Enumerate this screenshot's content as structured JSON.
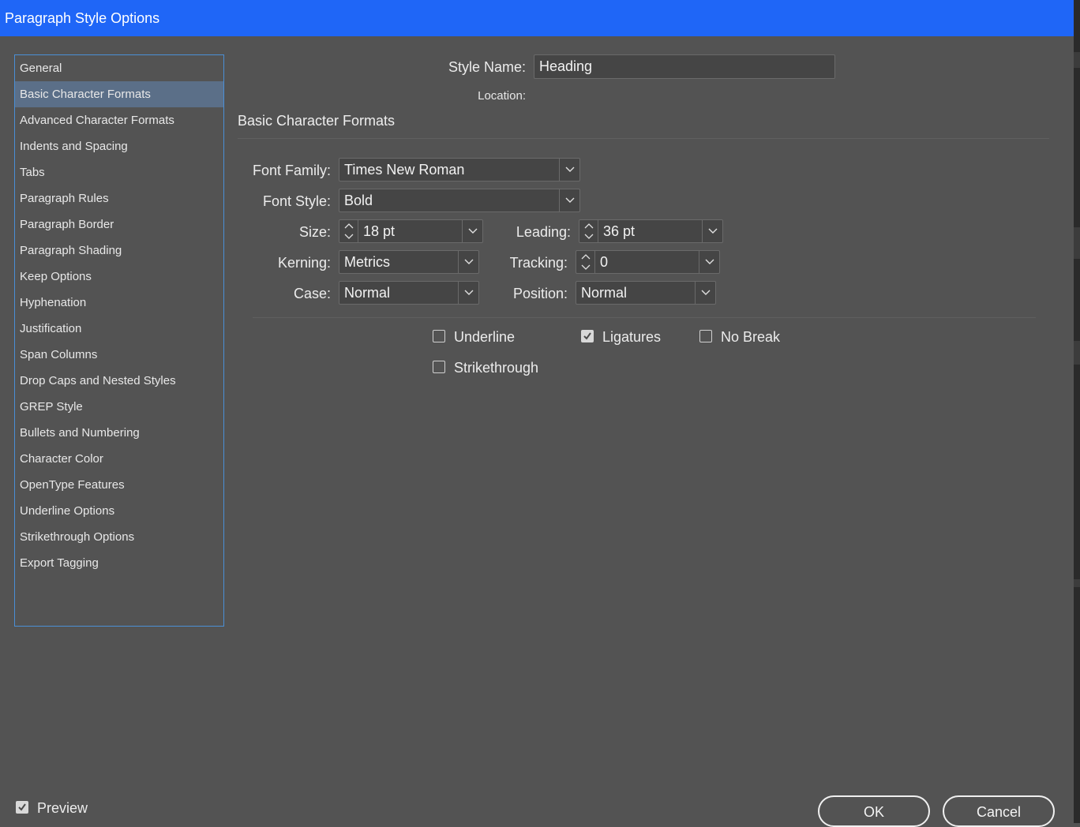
{
  "dialog": {
    "title": "Paragraph Style Options"
  },
  "sidebar": {
    "items": [
      {
        "label": "General"
      },
      {
        "label": "Basic Character Formats"
      },
      {
        "label": "Advanced Character Formats"
      },
      {
        "label": "Indents and Spacing"
      },
      {
        "label": "Tabs"
      },
      {
        "label": "Paragraph Rules"
      },
      {
        "label": "Paragraph Border"
      },
      {
        "label": "Paragraph Shading"
      },
      {
        "label": "Keep Options"
      },
      {
        "label": "Hyphenation"
      },
      {
        "label": "Justification"
      },
      {
        "label": "Span Columns"
      },
      {
        "label": "Drop Caps and Nested Styles"
      },
      {
        "label": "GREP Style"
      },
      {
        "label": "Bullets and Numbering"
      },
      {
        "label": "Character Color"
      },
      {
        "label": "OpenType Features"
      },
      {
        "label": "Underline Options"
      },
      {
        "label": "Strikethrough Options"
      },
      {
        "label": "Export Tagging"
      }
    ],
    "selected": "Basic Character Formats"
  },
  "style_name": {
    "label": "Style Name:",
    "value": "Heading"
  },
  "location": {
    "label": "Location:"
  },
  "section": {
    "title": "Basic Character Formats"
  },
  "fields": {
    "font_family": {
      "label": "Font Family:",
      "value": "Times New Roman"
    },
    "font_style": {
      "label": "Font Style:",
      "value": "Bold"
    },
    "size": {
      "label": "Size:",
      "value": "18 pt"
    },
    "leading": {
      "label": "Leading:",
      "value": "36 pt"
    },
    "kerning": {
      "label": "Kerning:",
      "value": "Metrics"
    },
    "tracking": {
      "label": "Tracking:",
      "value": "0"
    },
    "case": {
      "label": "Case:",
      "value": "Normal"
    },
    "position": {
      "label": "Position:",
      "value": "Normal"
    }
  },
  "checkboxes": {
    "underline": {
      "label": "Underline",
      "checked": false
    },
    "ligatures": {
      "label": "Ligatures",
      "checked": true
    },
    "no_break": {
      "label": "No Break",
      "checked": false
    },
    "strikethrough": {
      "label": "Strikethrough",
      "checked": false
    }
  },
  "footer": {
    "preview": {
      "label": "Preview",
      "checked": true
    },
    "ok_label": "OK",
    "cancel_label": "Cancel"
  },
  "colors": {
    "titlebar": "#1f66f7",
    "background": "#535353",
    "selected_item": "#5b6f88",
    "sidebar_border": "#4a8fd6"
  },
  "icons": [
    "chevron-down-icon",
    "spinner-up-icon",
    "spinner-down-icon",
    "checkmark-icon"
  ]
}
